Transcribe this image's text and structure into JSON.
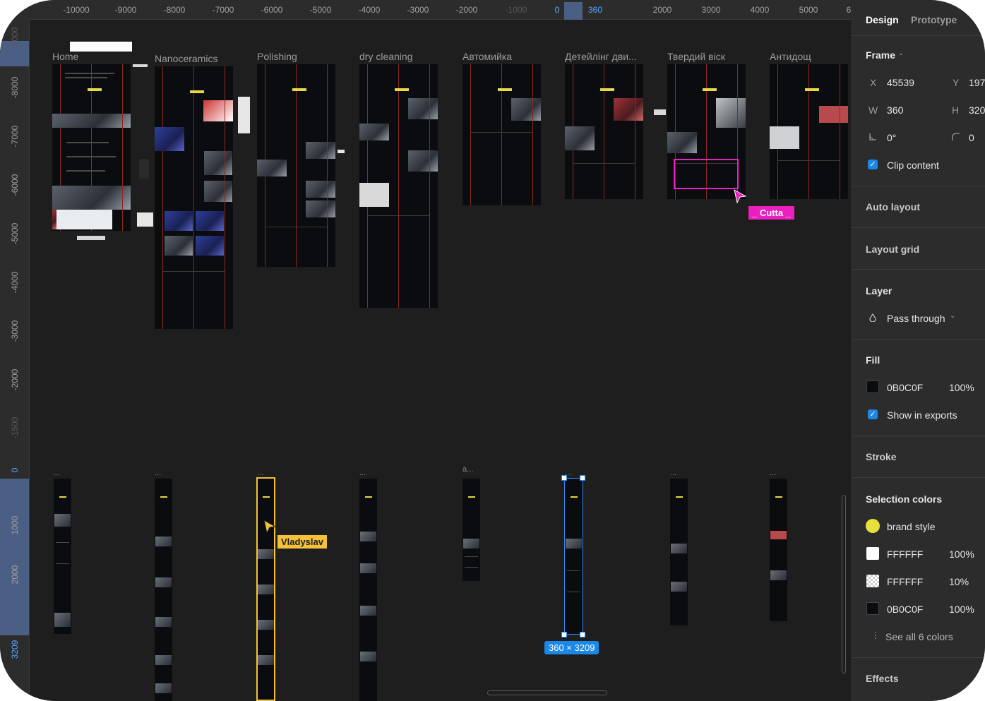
{
  "ruler": {
    "x_ticks": [
      "-10000",
      "-9000",
      "-8000",
      "-7000",
      "-6000",
      "-5000",
      "-4000",
      "-3000",
      "-2000",
      "-1000",
      "0",
      "360",
      "2000",
      "3000",
      "4000",
      "5000",
      "6"
    ],
    "y_ticks": [
      "-9000",
      "-8000",
      "-7000",
      "-6000",
      "-5000",
      "-4000",
      "-3000",
      "-2000",
      "-1500",
      "0",
      "1000",
      "2000",
      "3209"
    ]
  },
  "canvas": {
    "frames": [
      {
        "label": "Home"
      },
      {
        "label": "Nanoceramics"
      },
      {
        "label": "Polishing"
      },
      {
        "label": "dry cleaning"
      },
      {
        "label": "Автомийка"
      },
      {
        "label": "Детейлінг дви..."
      },
      {
        "label": "Твердий віск"
      },
      {
        "label": "Антидощ"
      }
    ],
    "mini_labels": [
      "...",
      "...",
      "...",
      "...",
      "a...",
      "...",
      "...",
      "..."
    ],
    "selection_size": "360 × 3209",
    "cursor_vladyslav": "Vladyslav",
    "cursor_cutta": "_ Cutta _"
  },
  "panel": {
    "tabs": {
      "design": "Design",
      "prototype": "Prototype"
    },
    "frame": {
      "title": "Frame",
      "x_label": "X",
      "x_value": "45539",
      "y_label": "Y",
      "y_value": "197",
      "w_label": "W",
      "w_value": "360",
      "h_label": "H",
      "h_value": "320",
      "rotation": "0°",
      "radius": "0",
      "clip_content": "Clip content"
    },
    "auto_layout": "Auto layout",
    "layout_grid": "Layout grid",
    "layer": {
      "title": "Layer",
      "blend": "Pass through"
    },
    "fill": {
      "title": "Fill",
      "hex": "0B0C0F",
      "opacity": "100%",
      "show_in_exports": "Show in exports"
    },
    "stroke": "Stroke",
    "selection_colors": {
      "title": "Selection colors",
      "items": [
        {
          "name": "brand style",
          "opacity": ""
        },
        {
          "name": "FFFFFF",
          "opacity": "100%"
        },
        {
          "name": "FFFFFF",
          "opacity": "10%"
        },
        {
          "name": "0B0C0F",
          "opacity": "100%"
        }
      ],
      "see_all": "See all 6 colors"
    },
    "effects": "Effects"
  },
  "colors": {
    "canvas_bg": "#1e1e1e",
    "panel_bg": "#2c2c2c",
    "accent_blue": "#1b87e6",
    "brand_yellow": "#e8e03a",
    "cursor_yellow": "#f3c13a",
    "cursor_pink": "#e91fbe",
    "frame_bg": "#0b0c0f"
  }
}
